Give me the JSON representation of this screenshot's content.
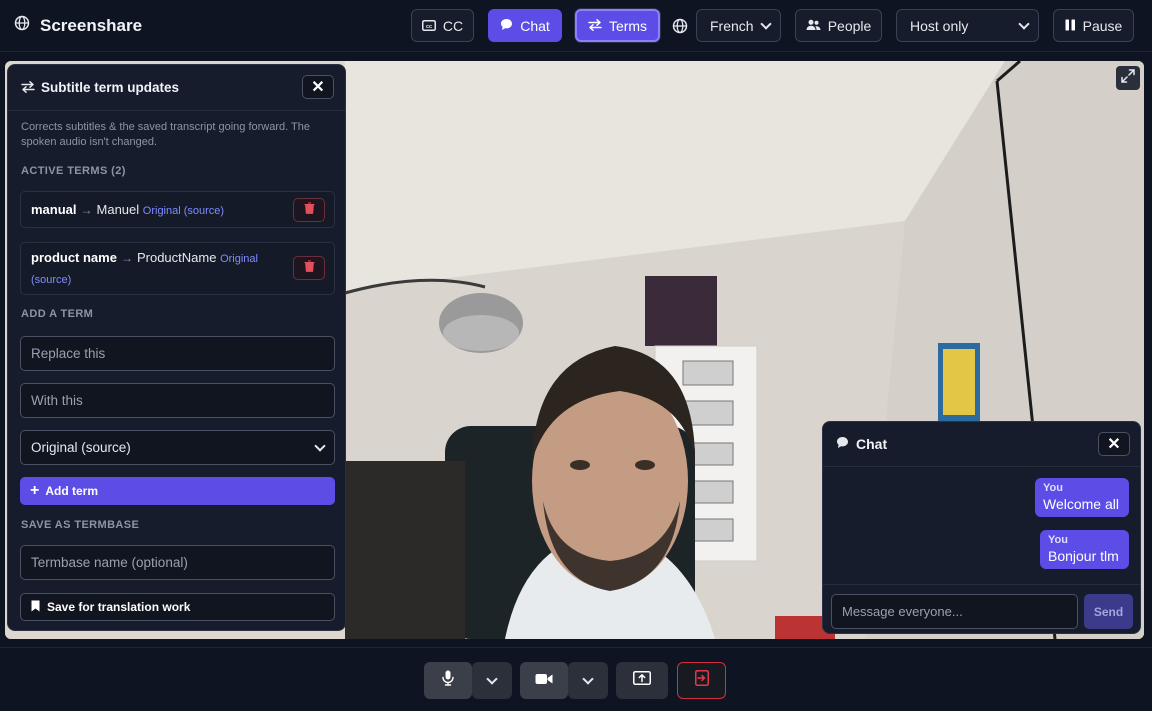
{
  "app": {
    "title": "Screenshare"
  },
  "topbar": {
    "cc_label": "CC",
    "chat_label": "Chat",
    "terms_label": "Terms",
    "language_selected": "French",
    "people_label": "People",
    "audience_selected": "Host only",
    "pause_label": "Pause"
  },
  "terms_panel": {
    "title": "Subtitle term updates",
    "note": "Corrects subtitles & the saved transcript going forward. The spoken audio isn't changed.",
    "active_header": "ACTIVE TERMS (2)",
    "terms": [
      {
        "source": "manual",
        "target": "Manuel",
        "scope": "Original (source)"
      },
      {
        "source": "product name",
        "target": "ProductName",
        "scope": "Original (source)"
      }
    ],
    "add_header": "ADD A TERM",
    "replace_placeholder": "Replace this",
    "with_placeholder": "With this",
    "scope_selected": "Original (source)",
    "add_button": "Add term",
    "save_header": "SAVE AS TERMBASE",
    "termbase_placeholder": "Termbase name (optional)",
    "save_button": "Save for translation work"
  },
  "chat_panel": {
    "title": "Chat",
    "messages": [
      {
        "author": "You",
        "text": "Welcome all"
      },
      {
        "author": "You",
        "text": "Bonjour tlm"
      }
    ],
    "input_placeholder": "Message everyone...",
    "send_label": "Send"
  },
  "colors": {
    "accent": "#5b4de6",
    "background": "#0f1422",
    "panel": "#161c2b",
    "leave_border": "#d12f3f"
  }
}
